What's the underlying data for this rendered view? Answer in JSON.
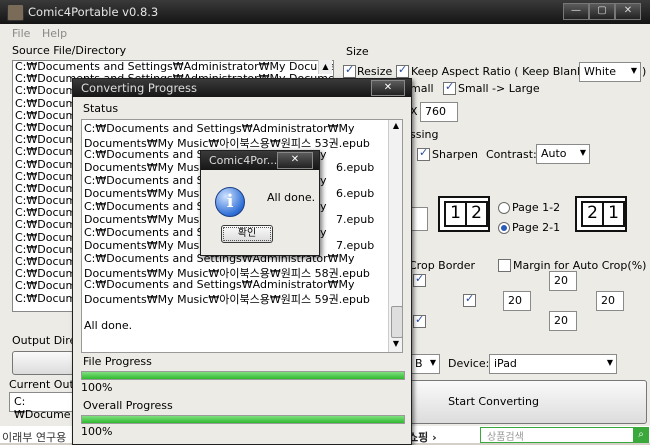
{
  "main": {
    "title": "Comic4Portable v0.8.3",
    "window_controls": [
      "—",
      "▢",
      "✕"
    ],
    "menu": [
      "File",
      "Help"
    ],
    "source_label": "Source File/Directory",
    "files": [
      "C:₩Documents and Settings₩Administrator₩My Docume",
      "C:₩Documents and Settings₩Administrator₩My Docume",
      "C:₩Documents and Settings₩Administrator₩My Docume",
      "C:₩Documents and Settings₩Administrator₩My Docume",
      "C:₩Documents and Settings₩Administrator₩My Docume",
      "C:₩Documents and Settings₩Administrator₩My Docume",
      "C:₩Documents and Settings₩Administrator₩My Docume",
      "C:₩Documents and Settings₩Administrator₩My Docume",
      "C:₩Documents and Settings₩Administrator₩My Docume",
      "C:₩Documents and Settings₩Administrator₩My Docume",
      "C:₩Documents and Settings₩Administrator₩My Docume",
      "C:₩Documents and Settings₩Administrator₩My Docume",
      "C:₩Documents and Settings₩Administrator₩My Docume",
      "C:₩Documents and Settings₩Administrator₩My Docume",
      "C:₩Documents and Settings₩Administrator₩My Docume",
      "C:₩Documents and Settings₩Administrator₩My Docume",
      "C:₩Documents and Settings₩Administrator₩My Docume",
      "C:₩Documents and Settings₩Administrator₩My Docume",
      "C:₩Documents and Settings₩Administrator₩My Docume",
      "C:₩Documents and Settings₩Administrator₩My Docume"
    ],
    "output_dir_label": "Output Dire",
    "current_output_label": "Current Out",
    "current_output_value": "C:₩Docume",
    "size_label": "Size",
    "resize_label": "Resize",
    "keep_aspect_label": "Keep Aspect Ratio ( Keep Blank:",
    "keep_blank_value": "White",
    "small_label": "mall",
    "small_large_label": "Small -> Large",
    "height_x_label": "X",
    "height_value": "760",
    "processing_label": "ssing",
    "sharpen_label": "Sharpen",
    "contrast_label": "Contrast:",
    "contrast_value": "Auto",
    "page12_glyphs": [
      "1",
      "2"
    ],
    "page21_glyphs": [
      "2",
      "1"
    ],
    "page12_label": "Page 1-2",
    "page21_label": "Page 2-1",
    "crop_border_label": "Crop Border",
    "margin_label": "Margin for Auto Crop(%)",
    "margins": {
      "top": "20",
      "left": "20",
      "right": "20",
      "bottom": "20"
    },
    "format_partial": "B",
    "device_label": "Device:",
    "device_value": "iPad",
    "start_button": "Start Converting",
    "footer_left": "이래부 연구용",
    "footer_mid": "쇼핑 ›",
    "search_placeholder": "상품검색"
  },
  "progress": {
    "title": "Converting Progress",
    "close": "✕",
    "status_label": "Status",
    "log": [
      "C:₩Documents and Settings₩Administrator₩My",
      "Documents₩My Music₩아이북스용₩원피스 53권.epub",
      "C:₩Documents and Se",
      "Documents₩My Music",
      "C:₩Documents and Se",
      "Documents₩My Music",
      "C:₩Documents and Se",
      "Documents₩My Music",
      "C:₩Documents and Se",
      "Documents₩My Music",
      "C:₩Documents and Settings₩Administrator₩My",
      "Documents₩My Music₩아이북스용₩원피스 58권.epub",
      "C:₩Documents and Settings₩Administrator₩My",
      "Documents₩My Music₩아이북스용₩원피스 59권.epub"
    ],
    "log_partial_right": [
      "y",
      "6.epub",
      "y",
      "6.epub",
      "y",
      "7.epub",
      "y",
      "7.epub"
    ],
    "done_text": "All done.",
    "file_progress_label": "File Progress",
    "file_progress_value": "100%",
    "file_progress": 1.0,
    "overall_progress_label": "Overall Progress",
    "overall_progress_value": "100%",
    "overall_progress": 1.0
  },
  "dialog": {
    "title": "Comic4Por...",
    "close": "✕",
    "message": "All done.",
    "ok_button": "확인"
  },
  "colors": {
    "titlebar": "#1e1e1e",
    "progress_fill": "#34c234",
    "accent": "#2b5ab8"
  }
}
